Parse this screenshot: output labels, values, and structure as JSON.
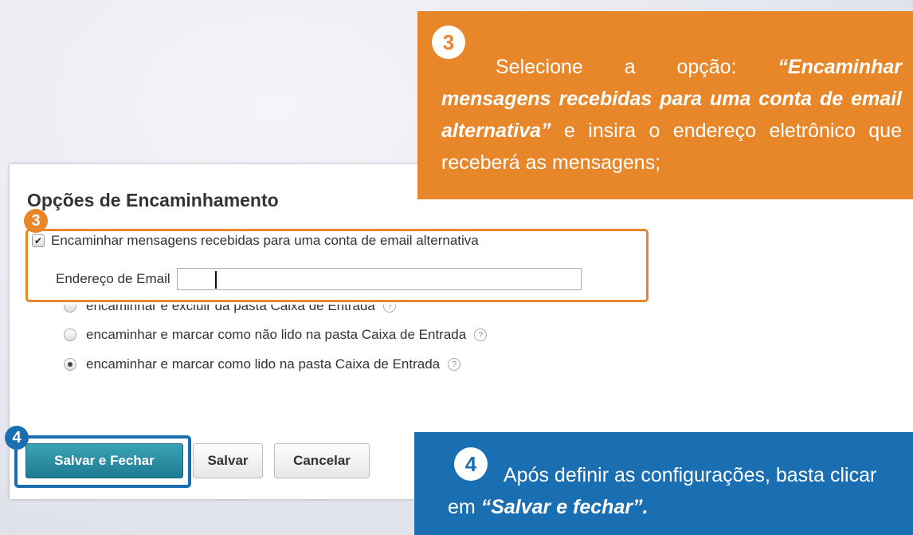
{
  "dialog": {
    "title": "Opções de Encaminhamento",
    "forward_checkbox_label": "Encaminhar mensagens recebidas para uma conta de email alternativa",
    "forward_checked": true,
    "email_label": "Endereço de Email",
    "email_value": "",
    "options": [
      {
        "label": "encaminhar e excluir da pasta Caixa de Entrada",
        "selected": false
      },
      {
        "label": "encaminhar e marcar como não lido na pasta Caixa de Entrada",
        "selected": false
      },
      {
        "label": "encaminhar e marcar como lido na pasta Caixa de Entrada",
        "selected": true
      }
    ],
    "help_icon_glyph": "?"
  },
  "buttons": {
    "save_close": "Salvar e Fechar",
    "save": "Salvar",
    "cancel": "Cancelar"
  },
  "badges": {
    "step3": "3",
    "step4": "4"
  },
  "callout3": {
    "number": "3",
    "lead": "Selecione a opção: ",
    "emphasis": "“Encaminhar mensagens recebidas para uma conta de email alternativa”",
    "tail": " e insira o endereço eletrônico que receberá as mensagens;"
  },
  "callout4": {
    "number": "4",
    "lead": "Após definir as configurações, basta clicar em ",
    "emphasis": "“Salvar e fechar”."
  },
  "colors": {
    "orange": "#e8862a",
    "blue": "#1a6eb2",
    "primary_button": "#1e7b92"
  }
}
